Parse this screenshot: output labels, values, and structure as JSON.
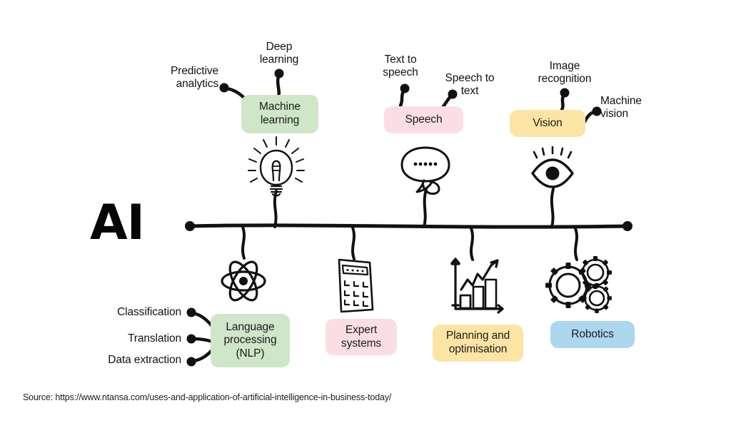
{
  "title": "AI uses and applications fishbone diagram",
  "root": {
    "label": "AI"
  },
  "colors": {
    "green": "#cfe6c8",
    "pink": "#fadee4",
    "yellow": "#fce5a4",
    "blue": "#abd7ef",
    "ink": "#111111",
    "background": "#ffffff"
  },
  "branches": {
    "upper": [
      {
        "id": "machine-learning",
        "pill_label": "Machine\nlearning",
        "color": "#cfe6c8",
        "icon": "lightbulb-icon",
        "leaves": [
          {
            "id": "predictive-analytics",
            "label": "Predictive\nanalytics",
            "align": "right"
          },
          {
            "id": "deep-learning",
            "label": "Deep\nlearning",
            "align": "center"
          }
        ]
      },
      {
        "id": "speech",
        "pill_label": "Speech",
        "color": "#fadee4",
        "icon": "speech-bubble-icon",
        "leaves": [
          {
            "id": "text-to-speech",
            "label": "Text to\nspeech",
            "align": "center"
          },
          {
            "id": "speech-to-text",
            "label": "Speech to\ntext",
            "align": "center"
          }
        ]
      },
      {
        "id": "vision",
        "pill_label": "Vision",
        "color": "#fce5a4",
        "icon": "eye-icon",
        "leaves": [
          {
            "id": "image-recognition",
            "label": "Image\nrecognition",
            "align": "center"
          },
          {
            "id": "machine-vision",
            "label": "Machine\nvision",
            "align": "left"
          }
        ]
      }
    ],
    "lower": [
      {
        "id": "language-processing",
        "pill_label": "Language\nprocessing\n(NLP)",
        "color": "#cfe6c8",
        "icon": "atom-icon",
        "leaves": [
          {
            "id": "classification",
            "label": "Classification",
            "align": "right"
          },
          {
            "id": "translation",
            "label": "Translation",
            "align": "right"
          },
          {
            "id": "data-extraction",
            "label": "Data extraction",
            "align": "right"
          }
        ]
      },
      {
        "id": "expert-systems",
        "pill_label": "Expert\nsystems",
        "color": "#fadee4",
        "icon": "calculator-icon",
        "leaves": []
      },
      {
        "id": "planning-and-optimisation",
        "pill_label": "Planning and\noptimisation",
        "color": "#fce5a4",
        "icon": "bar-chart-icon",
        "leaves": []
      },
      {
        "id": "robotics",
        "pill_label": "Robotics",
        "color": "#abd7ef",
        "icon": "gears-icon",
        "leaves": []
      }
    ]
  },
  "source": {
    "text": "Source: https://www.ntansa.com/uses-and-application-of-artificial-intelligence-in-business-today/"
  }
}
